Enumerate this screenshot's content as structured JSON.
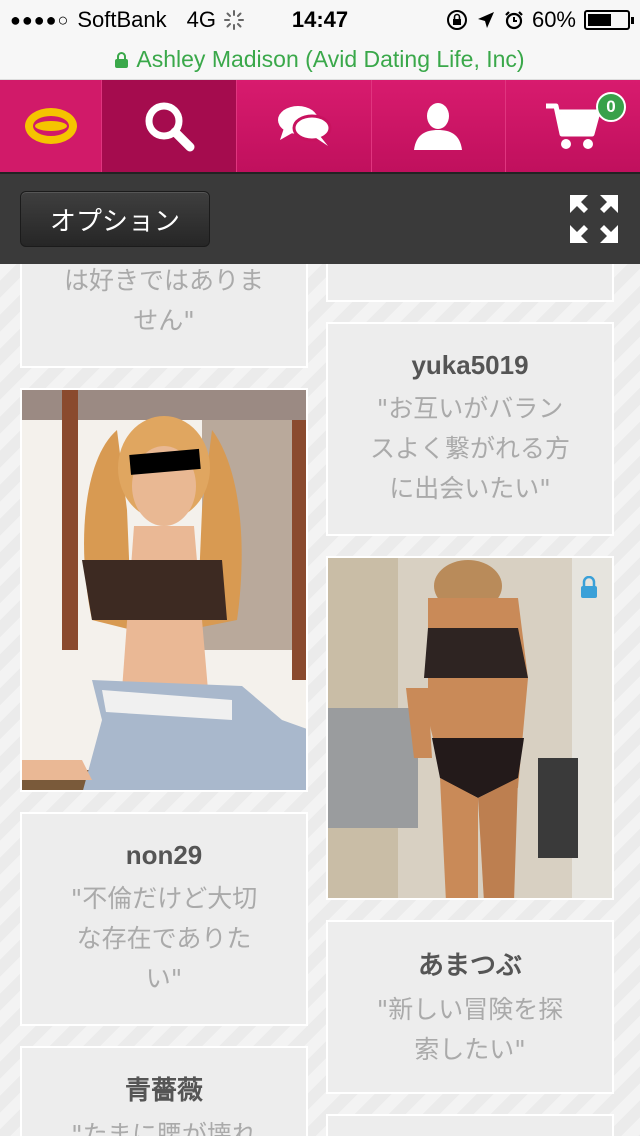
{
  "status_bar": {
    "signal_dots": "●●●●○",
    "carrier": "SoftBank",
    "network": "4G",
    "time": "14:47",
    "battery": "60%",
    "battery_level": 0.6
  },
  "url_bar": {
    "site_identity": "Ashley Madison (Avid Dating Life, Inc)"
  },
  "nav": {
    "items": [
      {
        "name": "logo",
        "icon": "ashley-madison-logo"
      },
      {
        "name": "search",
        "icon": "search-icon",
        "active": true
      },
      {
        "name": "messages",
        "icon": "chat-bubbles-icon"
      },
      {
        "name": "profile",
        "icon": "user-icon"
      },
      {
        "name": "cart",
        "icon": "cart-icon",
        "badge": "0"
      }
    ]
  },
  "toolbar": {
    "options_label": "オプション",
    "expand_icon": "expand-arrows-icon"
  },
  "feed": {
    "cards": [
      {
        "quote": "は好きではありま\nせん\""
      },
      {
        "quote": ""
      },
      {
        "username": "yuka5019",
        "quote": "\"お互いがバラン\nスよく繋がれる方\nに出会いたい\""
      },
      {
        "username": "non29",
        "quote": "\"不倫だけど大切\nな存在でありた\nい\""
      },
      {
        "username": "あまつぶ",
        "quote": "\"新しい冒険を探\n索したい\""
      },
      {
        "username": "青薔薇",
        "quote": "\"たまに腰が壊れ"
      }
    ],
    "colors": {
      "brand": "#cc1466",
      "badge_green": "#38a14a",
      "lock_blue": "#3aa0d8"
    }
  }
}
